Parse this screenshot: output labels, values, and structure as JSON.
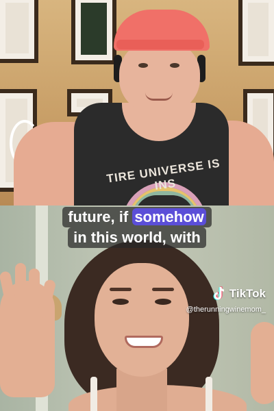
{
  "caption": {
    "line1_before": "future, if ",
    "line1_highlight": "somehow",
    "line2": "in this world, with"
  },
  "shirt_text": "TIRE UNIVERSE IS INS",
  "watermark": {
    "brand": "TikTok",
    "username": "@therunningwinemom_",
    "icon": "tiktok-logo-icon"
  },
  "colors": {
    "highlight": "#5b4ed8",
    "cap": "#f07068"
  }
}
